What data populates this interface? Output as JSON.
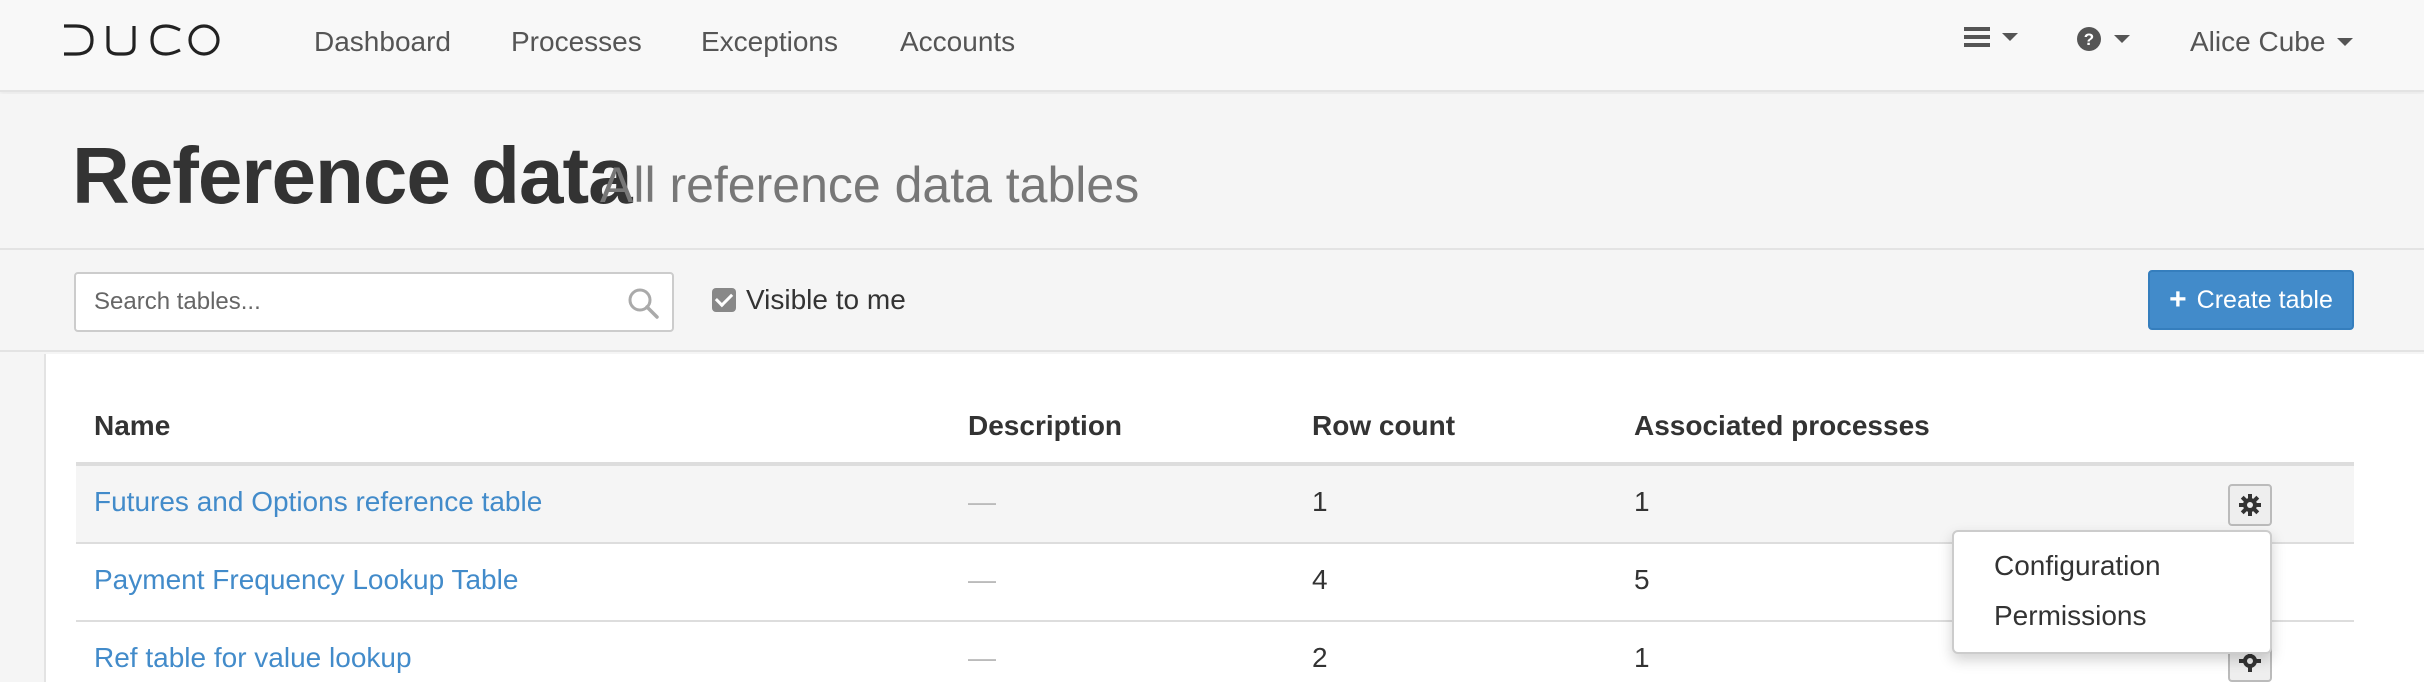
{
  "brand": {
    "logo_text": "DUCO"
  },
  "nav": {
    "links": [
      "Dashboard",
      "Processes",
      "Exceptions",
      "Accounts"
    ],
    "menu_icon": "hamburger-menu-icon",
    "help_icon": "question-circle-icon",
    "user_name": "Alice Cube"
  },
  "header": {
    "title": "Reference data",
    "subtitle": "All reference data tables"
  },
  "toolbar": {
    "search_placeholder": "Search tables...",
    "search_value": "",
    "visible_to_me_label": "Visible to me",
    "visible_to_me_checked": true,
    "create_label": "Create table"
  },
  "table": {
    "columns": [
      "Name",
      "Description",
      "Row count",
      "Associated processes"
    ],
    "rows": [
      {
        "name": "Futures and Options reference table",
        "description": "—",
        "row_count": "1",
        "processes": "1"
      },
      {
        "name": "Payment Frequency Lookup Table",
        "description": "—",
        "row_count": "4",
        "processes": "5"
      },
      {
        "name": "Ref table for value lookup",
        "description": "—",
        "row_count": "2",
        "processes": "1"
      }
    ]
  },
  "dropdown": {
    "items": [
      "Configuration",
      "Permissions"
    ]
  },
  "colors": {
    "primary": "#428bca",
    "link": "#428bca",
    "navbar_bg": "#f8f8f8"
  }
}
